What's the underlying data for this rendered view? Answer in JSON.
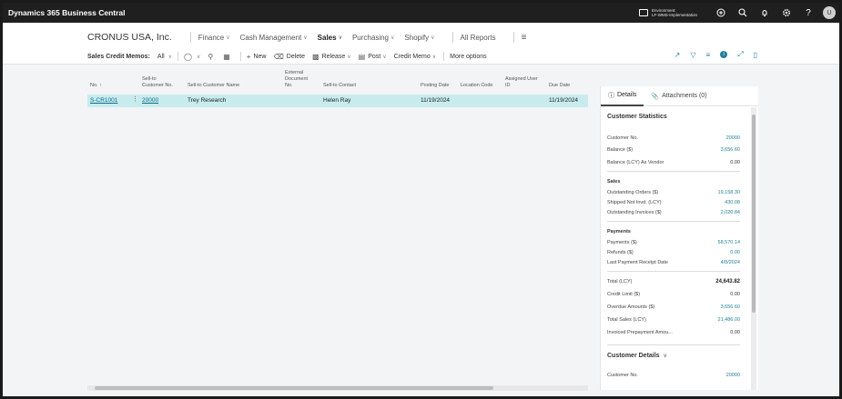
{
  "app": {
    "title": "Dynamics 365 Business Central",
    "environment_label": "Environment:",
    "environment_name": "LF-WMS-Implementation",
    "user_initial": "U"
  },
  "topbar_icons": [
    "copilot-icon",
    "search-icon",
    "bell-icon",
    "settings-icon",
    "help-icon"
  ],
  "nav": {
    "company": "CRONUS USA, Inc.",
    "items": [
      {
        "label": "Finance",
        "has_chevron": true
      },
      {
        "label": "Cash Management",
        "has_chevron": true
      },
      {
        "label": "Sales",
        "has_chevron": true,
        "active": true
      },
      {
        "label": "Purchasing",
        "has_chevron": true
      },
      {
        "label": "Shopify",
        "has_chevron": true
      }
    ],
    "all_reports": "All Reports"
  },
  "actions": {
    "page_name": "Sales Credit Memos:",
    "filter": "All",
    "new": "New",
    "delete": "Delete",
    "release": "Release",
    "post": "Post",
    "credit_memo": "Credit Memo",
    "more_options": "More options"
  },
  "list": {
    "columns": {
      "no": "No. ↑",
      "sell_to_customer_no": "Sell-to Customer No.",
      "sell_to_customer_name": "Sell-to Customer Name",
      "external_document_no": "External Document No.",
      "sell_to_contact": "Sell-to Contact",
      "posting_date": "Posting Date",
      "location_code": "Location Code",
      "assigned_user_id": "Assigned User ID",
      "due_date": "Due Date"
    },
    "rows": [
      {
        "no": "S-CR1001",
        "sell_to_customer_no": "20000",
        "sell_to_customer_name": "Trey Research",
        "external_document_no": "",
        "sell_to_contact": "Helen Ray",
        "posting_date": "11/19/2024",
        "location_code": "",
        "assigned_user_id": "",
        "due_date": "11/19/2024"
      }
    ]
  },
  "factbox": {
    "tabs": {
      "details": "Details",
      "attachments": "Attachments (0)"
    },
    "stats_title": "Customer Statistics",
    "customer_no_label": "Customer No.",
    "customer_no": "20000",
    "balance_label": "Balance ($)",
    "balance": "3,656.60",
    "balance_vendor_label": "Balance (LCY) As Vendor",
    "balance_vendor": "0.00",
    "sales_header": "Sales",
    "outstanding_orders_label": "Outstanding Orders ($)",
    "outstanding_orders": "19,158.30",
    "shipped_not_invd_label": "Shipped Not Invd. (LCY)",
    "shipped_not_invd": "430.08",
    "outstanding_invoices_label": "Outstanding Invoices ($)",
    "outstanding_invoices": "2,020.84",
    "payments_header": "Payments",
    "payments_label": "Payments ($)",
    "payments": "58,570.14",
    "refunds_label": "Refunds ($)",
    "refunds": "0.00",
    "last_payment_label": "Last Payment Receipt Date",
    "last_payment": "4/8/2024",
    "total_label": "Total (LCY)",
    "total": "24,643.82",
    "credit_limit_label": "Credit Limit ($)",
    "credit_limit": "0.00",
    "overdue_label": "Overdue Amounts ($)",
    "overdue": "3,656.60",
    "total_sales_label": "Total Sales (LCY)",
    "total_sales": "21,486.00",
    "invoiced_prepayment_label": "Invoiced Prepayment Amou...",
    "invoiced_prepayment": "0.00",
    "details_title": "Customer Details",
    "details_customer_no_label": "Customer No.",
    "details_customer_no": "20000"
  }
}
